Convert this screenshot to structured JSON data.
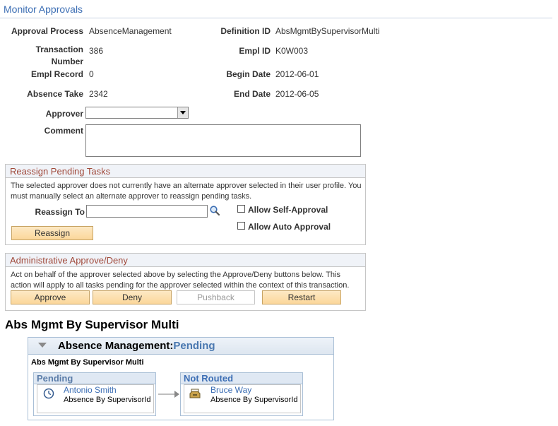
{
  "page": {
    "title": "Monitor Approvals"
  },
  "fields": {
    "approval_process": {
      "label": "Approval Process",
      "value": "AbsenceManagement"
    },
    "definition_id": {
      "label": "Definition ID",
      "value": "AbsMgmtBySupervisorMulti"
    },
    "transaction_number": {
      "label_line1": "Transaction",
      "label_line2": "Number",
      "value": "386"
    },
    "empl_id": {
      "label": "Empl ID",
      "value": "K0W003"
    },
    "empl_record": {
      "label": "Empl Record",
      "value": "0"
    },
    "begin_date": {
      "label": "Begin Date",
      "value": "2012-06-01"
    },
    "absence_take": {
      "label": "Absence Take",
      "value": "2342"
    },
    "end_date": {
      "label": "End Date",
      "value": "2012-06-05"
    },
    "approver": {
      "label": "Approver",
      "value": ""
    },
    "comment": {
      "label": "Comment",
      "value": ""
    }
  },
  "reassign": {
    "title": "Reassign Pending Tasks",
    "note_line1": "The selected approver does not currently have an alternate approver selected in their user profile.  You",
    "note_line2": "must manually select an alternate approver to reassign pending tasks.",
    "reassign_to_label": "Reassign To",
    "reassign_to_value": "",
    "allow_self_approval": "Allow Self-Approval",
    "allow_auto_approval": "Allow Auto Approval",
    "button": "Reassign"
  },
  "admin": {
    "title": "Administrative Approve/Deny",
    "note_line1": "Act on behalf of the approver selected above by selecting the Approve/Deny buttons below.  This",
    "note_line2": "action will apply to all tasks pending for the approver selected within the context of this transaction.",
    "buttons": {
      "approve": "Approve",
      "deny": "Deny",
      "pushback": "Pushback",
      "restart": "Restart"
    }
  },
  "workflow": {
    "title": "Abs Mgmt By Supervisor Multi",
    "header_name": "Absence Management:",
    "header_status": "Pending",
    "subtitle": "Abs Mgmt By Supervisor Multi",
    "stages": [
      {
        "status": "Pending",
        "person": "Antonio Smith",
        "role": "Absence By SupervisorId",
        "icon": "clock-icon"
      },
      {
        "status": "Not Routed",
        "person": "Bruce Way",
        "role": "Absence By SupervisorId",
        "icon": "inbox-icon"
      }
    ]
  },
  "colors": {
    "accent": "#3c6eb4",
    "section_title": "#a0493a",
    "button": "#fbd79a"
  }
}
